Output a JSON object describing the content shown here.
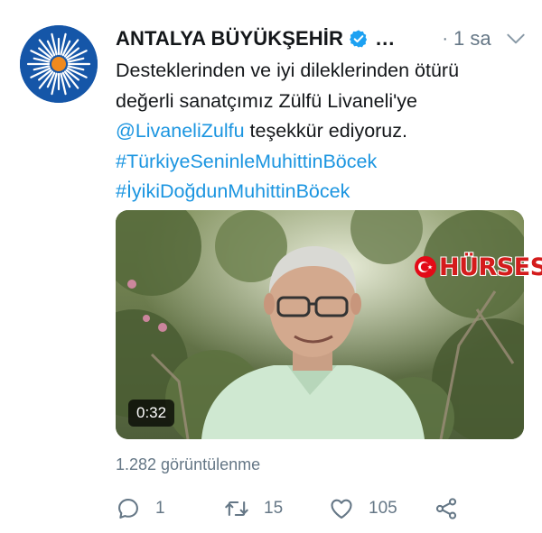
{
  "tweet": {
    "author_name": "ANTALYA BÜYÜKŞEHİR",
    "handle_truncated": "...",
    "separator": "·",
    "time": "1 sa",
    "text_lines": [
      "Desteklerinden ve iyi dileklerinden ötürü",
      "değerli sanatçımız Zülfü Livaneli'ye"
    ],
    "mention": "@LivaneliZulfu",
    "mention_suffix": " teşekkür ediyoruz.",
    "hashtags": [
      "#TürkiyeSeninleMuhittinBöcek",
      "#İyikiDoğdunMuhittinBöcek"
    ]
  },
  "media": {
    "duration": "0:32",
    "watermark": "HÜRSES"
  },
  "stats": {
    "views": "1.282 görüntülenme",
    "replies": "1",
    "retweets": "15",
    "likes": "105"
  },
  "icons": {
    "verified": "verified-badge-icon",
    "more": "chevron-down-icon",
    "reply": "reply-icon",
    "retweet": "retweet-icon",
    "like": "heart-icon",
    "share": "share-icon"
  },
  "colors": {
    "link": "#1b95e0",
    "muted": "#657786",
    "avatar_bg": "#1556a8",
    "avatar_sun": "#f08a1f",
    "verified": "#1da1f2"
  }
}
